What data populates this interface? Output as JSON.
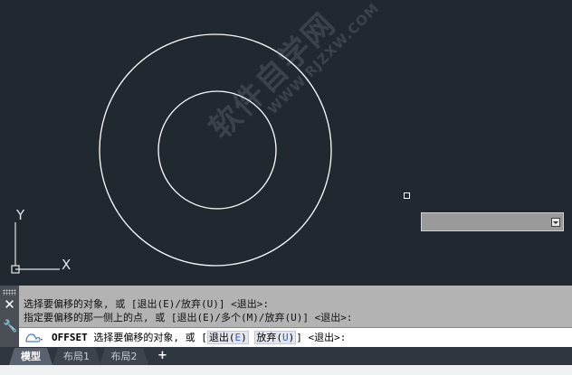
{
  "viewport": {
    "ucs": {
      "y_label": "Y",
      "x_label": "X"
    },
    "watermark": {
      "main": "软件自学网",
      "url": "WWW.RJZXW.COM"
    }
  },
  "command_line": {
    "history": [
      "选择要偏移的对象, 或 [退出(E)/放弃(U)] <退出>:",
      "指定要偏移的那一侧上的点, 或 [退出(E)/多个(M)/放弃(U)] <退出>:"
    ],
    "input": {
      "command": "OFFSET",
      "prompt": "选择要偏移的对象, 或 [",
      "option1_text": "退出(",
      "option1_key": "E",
      "option1_close": ")",
      "option2_text": "放弃(",
      "option2_key": "U",
      "option2_close": ")",
      "suffix": "] <退出>:"
    },
    "icons": {
      "close": "close-icon",
      "customize": "wrench-icon",
      "command": "command-prompt-icon"
    }
  },
  "tabs": {
    "items": [
      {
        "label": "模型",
        "active": true
      },
      {
        "label": "布局1",
        "active": false
      },
      {
        "label": "布局2",
        "active": false
      }
    ],
    "add_label": "+"
  },
  "colors": {
    "canvas": "#212830",
    "geometry": "#ffffff",
    "command_panel": "#b3b3b3",
    "option_key": "#2b5fc9"
  }
}
